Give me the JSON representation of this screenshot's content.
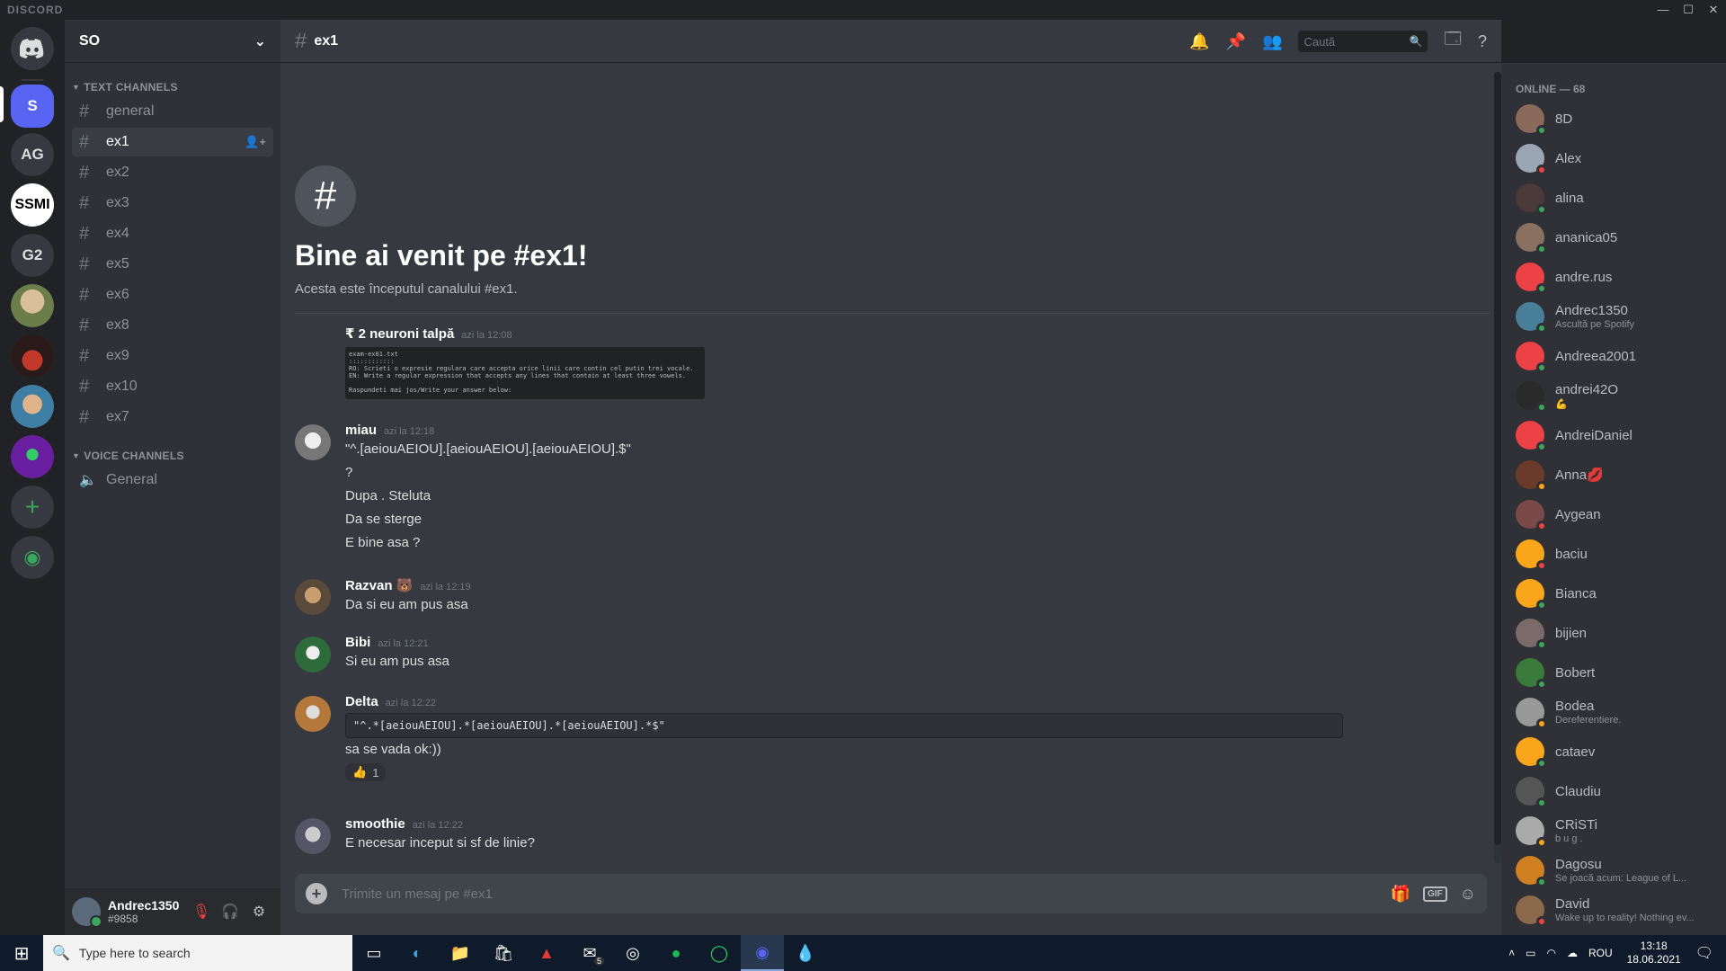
{
  "app": {
    "brand": "DISCORD",
    "window_controls": [
      "—",
      "☐",
      "✕"
    ]
  },
  "guilds": [
    {
      "label": "S",
      "active": true
    },
    {
      "label": "AG"
    },
    {
      "label": "SSMI"
    },
    {
      "label": "G2"
    }
  ],
  "server": {
    "name": "SO"
  },
  "categories": {
    "text": "TEXT CHANNELS",
    "voice": "VOICE CHANNELS"
  },
  "channels": [
    "general",
    "ex1",
    "ex2",
    "ex3",
    "ex4",
    "ex5",
    "ex6",
    "ex8",
    "ex9",
    "ex10",
    "ex7"
  ],
  "active_channel": "ex1",
  "voice_channels": [
    "General"
  ],
  "user": {
    "name": "Andrec1350",
    "tag": "#9858"
  },
  "header": {
    "channel": "ex1",
    "search_placeholder": "Caută"
  },
  "welcome": {
    "title": "Bine ai venit pe #ex1!",
    "subtitle": "Acesta este începutul canalului #ex1."
  },
  "messages": [
    {
      "author": "₹ 2 neuroni talpă",
      "time": "azi la 12:08",
      "attachment": [
        "exam-ex01.txt",
        "::::::::::::",
        "RO: Scrieti o expresie regulara care accepta orice linii care contin cel putin trei vocale.",
        "EN: Write a regular expression that accepts any lines that contain at least three vowels.",
        "",
        "Raspundeti mai jos/Write your answer below:"
      ]
    },
    {
      "author": "miau",
      "time": "azi la 12:18",
      "lines": [
        "\"^.[aeiouAEIOU].[aeiouAEIOU].[aeiouAEIOU].$\"",
        "?",
        "Dupa . Steluta",
        "Da se sterge",
        "E bine asa ?"
      ]
    },
    {
      "author": "Razvan 🐻",
      "time": "azi la 12:19",
      "lines": [
        "Da si eu am pus asa"
      ]
    },
    {
      "author": "Bibi",
      "time": "azi la 12:21",
      "lines": [
        "Si eu am pus asa"
      ]
    },
    {
      "author": "Delta",
      "time": "azi la 12:22",
      "code": "\"^.*[aeiouAEIOU].*[aeiouAEIOU].*[aeiouAEIOU].*$\"",
      "lines": [
        "sa se vada ok:))"
      ],
      "reaction": {
        "emoji": "👍",
        "count": "1"
      }
    },
    {
      "author": "smoothie",
      "time": "azi la 12:22",
      "lines": [
        "E necesar inceput si sf de linie?"
      ]
    }
  ],
  "composer": {
    "placeholder": "Trimite un mesaj pe #ex1",
    "gif": "GIF"
  },
  "members": {
    "heading": "ONLINE — 68",
    "list": [
      {
        "name": "8D",
        "status_color": "#3ba55d"
      },
      {
        "name": "Alex",
        "status_color": "#ed4245"
      },
      {
        "name": "alina",
        "status_color": "#3ba55d"
      },
      {
        "name": "ananica05",
        "status_color": "#3ba55d"
      },
      {
        "name": "andre.rus",
        "status_color": "#3ba55d"
      },
      {
        "name": "Andrec1350",
        "activity": "Ascultă pe Spotify",
        "status_color": "#3ba55d"
      },
      {
        "name": "Andreea2001",
        "status_color": "#3ba55d"
      },
      {
        "name": "andrei42O",
        "activity": "💪",
        "status_color": "#3ba55d"
      },
      {
        "name": "AndreiDaniel",
        "status_color": "#3ba55d"
      },
      {
        "name": "Anna💋",
        "status_color": "#faa61a"
      },
      {
        "name": "Aygean",
        "status_color": "#ed4245"
      },
      {
        "name": "baciu",
        "status_color": "#ed4245"
      },
      {
        "name": "Bianca",
        "status_color": "#3ba55d"
      },
      {
        "name": "bijien",
        "status_color": "#3ba55d"
      },
      {
        "name": "Bobert",
        "status_color": "#3ba55d"
      },
      {
        "name": "Bodea",
        "activity": "Dereferentiere.",
        "status_color": "#faa61a"
      },
      {
        "name": "cataev",
        "status_color": "#3ba55d"
      },
      {
        "name": "Claudiu",
        "status_color": "#3ba55d"
      },
      {
        "name": "CRiSTi",
        "activity": "b u g .",
        "status_color": "#faa61a"
      },
      {
        "name": "Dagosu",
        "activity": "Se joacă acum: League of L...",
        "status_color": "#3ba55d"
      },
      {
        "name": "David",
        "activity": "Wake up to reality! Nothing ev...",
        "status_color": "#ed4245"
      }
    ]
  },
  "taskbar": {
    "search_placeholder": "Type here to search",
    "lang": "ROU",
    "time": "13:18",
    "date": "18.06.2021",
    "mail_badge": "5"
  }
}
